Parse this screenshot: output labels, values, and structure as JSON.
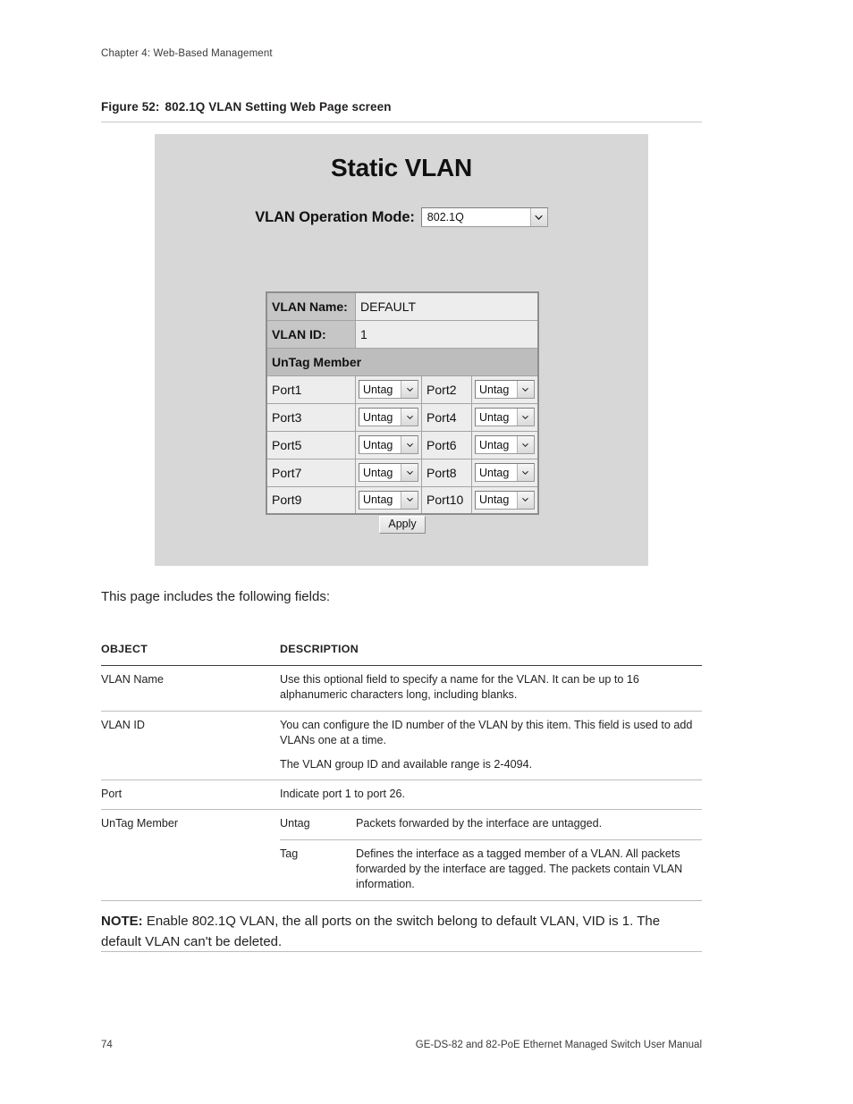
{
  "header": {
    "chapter": "Chapter 4: Web-Based Management"
  },
  "figure": {
    "number": "Figure 52:",
    "title": "802.1Q VLAN Setting Web Page screen"
  },
  "screenshot": {
    "title": "Static VLAN",
    "operation_mode": {
      "label": "VLAN Operation Mode:",
      "value": "802.1Q"
    },
    "form": {
      "vlan_name_label": "VLAN Name:",
      "vlan_name_value": "DEFAULT",
      "vlan_id_label": "VLAN ID:",
      "vlan_id_value": "1",
      "untag_member_label": "UnTag Member",
      "port_rows": [
        {
          "left_port": "Port1",
          "left_value": "Untag",
          "right_port": "Port2",
          "right_value": "Untag"
        },
        {
          "left_port": "Port3",
          "left_value": "Untag",
          "right_port": "Port4",
          "right_value": "Untag"
        },
        {
          "left_port": "Port5",
          "left_value": "Untag",
          "right_port": "Port6",
          "right_value": "Untag"
        },
        {
          "left_port": "Port7",
          "left_value": "Untag",
          "right_port": "Port8",
          "right_value": "Untag"
        },
        {
          "left_port": "Port9",
          "left_value": "Untag",
          "right_port": "Port10",
          "right_value": "Untag"
        }
      ],
      "apply_label": "Apply"
    },
    "colors": {
      "page_background": "#d7d7d7",
      "label_cell_background": "#c6c6c6",
      "section_cell_background": "#bdbdbd",
      "value_cell_background": "#ededed",
      "label_text": "#1f3f82"
    }
  },
  "lead_text": "This page includes the following fields:",
  "desc_table": {
    "headers": {
      "object": "OBJECT",
      "description": "DESCRIPTION"
    },
    "rows": [
      {
        "object": "VLAN Name",
        "paragraphs": [
          "Use this optional field to specify a name for the VLAN. It can be up to 16 alphanumeric characters long, including blanks."
        ]
      },
      {
        "object": "VLAN ID",
        "paragraphs": [
          "You can configure the ID number of the VLAN by this item. This field is used to add VLANs one at a time.",
          "The VLAN group ID and available range is 2-4094."
        ]
      },
      {
        "object": "Port",
        "paragraphs": [
          "Indicate port 1 to port 26."
        ]
      }
    ],
    "untag_member": {
      "object": "UnTag Member",
      "sub_rows": [
        {
          "sub": "Untag",
          "text": "Packets forwarded by the interface are untagged."
        },
        {
          "sub": "Tag",
          "text": "Defines the interface as a tagged member of a VLAN. All packets forwarded by the interface are tagged. The packets contain VLAN information."
        }
      ]
    }
  },
  "note": {
    "label": "NOTE:",
    "text": " Enable 802.1Q VLAN, the all ports on the switch belong to default VLAN, VID is 1. The default VLAN can't be deleted."
  },
  "footer": {
    "page_number": "74",
    "manual_title": "GE-DS-82 and 82-PoE Ethernet Managed Switch User Manual"
  }
}
